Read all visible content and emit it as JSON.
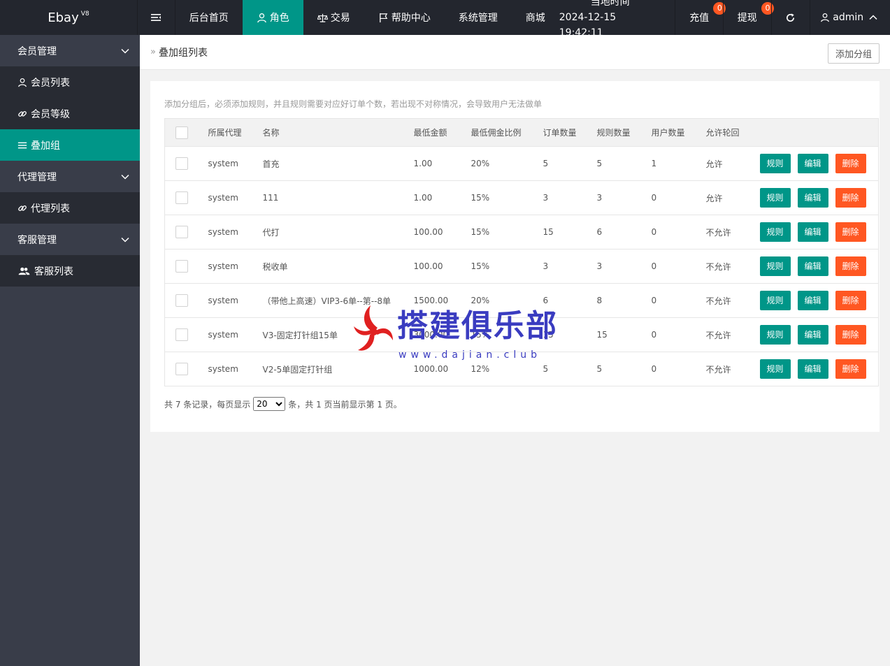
{
  "header": {
    "logo": "Ebay",
    "logo_version": "V8",
    "nav": [
      {
        "label": "后台首页",
        "active": false
      },
      {
        "label": "角色",
        "active": true
      },
      {
        "label": "交易",
        "active": false
      },
      {
        "label": "帮助中心",
        "active": false
      },
      {
        "label": "系统管理",
        "active": false
      },
      {
        "label": "商城",
        "active": false
      }
    ],
    "time_label": "当地时间",
    "time_value": "2024-12-15 19:42:11",
    "recharge": {
      "label": "充值",
      "badge": "0"
    },
    "withdraw": {
      "label": "提现",
      "badge": "0"
    },
    "user": "admin"
  },
  "sidebar": {
    "groups": [
      {
        "label": "会员管理",
        "items": [
          {
            "label": "会员列表",
            "icon": "user-icon",
            "active": false
          },
          {
            "label": "会员等级",
            "icon": "link-icon",
            "active": false
          },
          {
            "label": "叠加组",
            "icon": "list-icon",
            "active": true
          }
        ]
      },
      {
        "label": "代理管理",
        "items": [
          {
            "label": "代理列表",
            "icon": "link-icon",
            "active": false
          }
        ]
      },
      {
        "label": "客服管理",
        "items": [
          {
            "label": "客服列表",
            "icon": "users-icon",
            "active": false
          }
        ]
      }
    ]
  },
  "page": {
    "breadcrumb": "叠加组列表",
    "add_button": "添加分组",
    "tip": "添加分组后，必须添加规则，并且规则需要对应好订单个数，若出现不对称情况，会导致用户无法做单"
  },
  "table": {
    "headers": [
      "所属代理",
      "名称",
      "最低金额",
      "最低佣金比例",
      "订单数量",
      "规则数量",
      "用户数量",
      "允许轮回"
    ],
    "actions": {
      "rule": "规则",
      "edit": "编辑",
      "delete": "删除"
    },
    "rows": [
      [
        "system",
        "首充",
        "1.00",
        "20%",
        "5",
        "5",
        "1",
        "允许"
      ],
      [
        "system",
        "111",
        "1.00",
        "15%",
        "3",
        "3",
        "0",
        "允许"
      ],
      [
        "system",
        "代打",
        "100.00",
        "15%",
        "15",
        "6",
        "0",
        "不允许"
      ],
      [
        "system",
        "税收单",
        "100.00",
        "15%",
        "3",
        "3",
        "0",
        "不允许"
      ],
      [
        "system",
        "（带他上高速）VIP3-6单--第--8单",
        "1500.00",
        "20%",
        "6",
        "8",
        "0",
        "不允许"
      ],
      [
        "system",
        "V3-固定打针组15单",
        "3000.00",
        "15%",
        "15",
        "15",
        "0",
        "不允许"
      ],
      [
        "system",
        "V2-5单固定打针组",
        "1000.00",
        "12%",
        "5",
        "5",
        "0",
        "不允许"
      ]
    ]
  },
  "pager": {
    "prefix": "共 7 条记录，每页显示",
    "page_size": "20",
    "suffix": "条，共 1 页当前显示第 1 页。"
  },
  "watermark": {
    "text": "搭建俱乐部",
    "url": "www.dajian.club"
  },
  "colors": {
    "accent": "#009688",
    "danger": "#ff5722",
    "topbar": "#23262e",
    "sidebar": "#393d49"
  }
}
